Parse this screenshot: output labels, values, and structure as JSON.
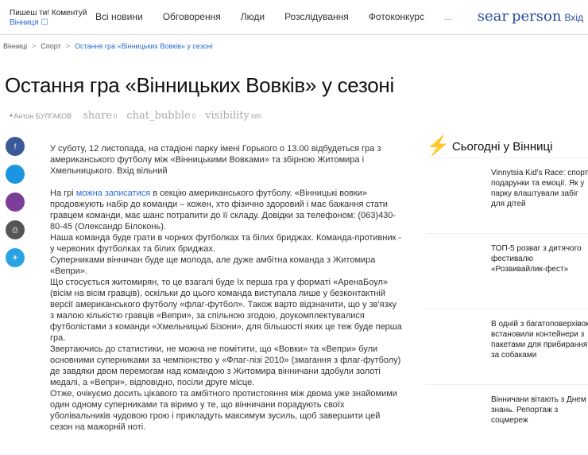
{
  "header": {
    "brand_line1": "Пишеш ти! Коментуй",
    "brand_line2": "Вінниця ☐",
    "nav": [
      "Всі новини",
      "Обговорення",
      "Люди",
      "Розслідування",
      "Фотоконкурс",
      "..."
    ],
    "search_icon": "sear",
    "person_icon": "person",
    "login": "Вхід"
  },
  "breadcrumb": {
    "items": [
      "Вінниці",
      "Спорт"
    ],
    "separator": ">",
    "current": "Остання гра «Вінницьких Вовків» у сезоні"
  },
  "article": {
    "title": "Остання гра «Вінницьких Вовків» у сезоні",
    "author": "Антон БУЛГАКОВ",
    "share_label": "share",
    "share_count": "0",
    "comments_label": "chat_bubble",
    "comments_count": "0",
    "views_label": "visibility",
    "views_count": "685",
    "lead": "У суботу, 12 листопада, на стадіоні парку імені Горького о 13.00 відбудеться гра з американського футболу між «Вінницькими Вовками» та збірною Житомира і Хмельницького. Вхід вільний",
    "p2_before": "На грі ",
    "p2_link": "можна записатися",
    "p2_after": " в секцію американського футболу. «Вінницькі вовки» продовжують набір до команди – кожен, хто фізично здоровий і має бажання стати гравцем команди, має шанс потрапити до її складу. Довідки за телефоном: (063)430-80-45 (Олександр Білоконь).",
    "p3": "Наша команда буде грати в чорних футболках та білих бриджах. Команда-противник - у червоних футболках та білих бриджах.",
    "p4": "Суперниками вінничан буде ще молода, але дуже амбітна команда з Житомира «Вепри».",
    "p5": "Що стосується житомирян, то це взагалі буде їх перша гра у форматі «АренаБоул» (вісім на вісім гравців), оскільки до цього команда виступала лише у безконтактній версії американського футболу «флаг-футбол». Також варто відзначити, що у зв'язку з малою кількістю гравців «Вепри», за спільною згодою, доукомплектувалися футболістами з команди «Хмельницькі Бізони», для більшості яких це теж буде перша гра.",
    "p6": "Звертаючись до статистики, не можна не помітити, що «Вовки» та «Вепри» були основними суперниками за чемпіонство у «Флаг-лізі 2010» (змагання з флаг-футболу) де завдяки двом перемогам над командою з Житомира вінничани здобули золоті медалі, а «Вепри», відповідно, посіли друге місце.",
    "p7": "Отже, очікуємо досить цікавого та амбітного протистояння між двома уже знайомими один одному суперниками та віримо у те, що вінничани порадують своїх уболівальників чудовою грою і прикладуть максимум зусиль, щоб завершити цей сезон на мажорній ноті."
  },
  "share_buttons": [
    {
      "icon": "facebook-icon",
      "label": "f",
      "color": "#3b5998"
    },
    {
      "icon": "twitter-icon",
      "label": "",
      "color": "#1b95e0"
    },
    {
      "icon": "viber-icon",
      "label": "",
      "color": "#7b3f98"
    },
    {
      "icon": "print-icon",
      "label": "⎙",
      "color": "#555555"
    },
    {
      "icon": "telegram-icon",
      "label": "✈",
      "color": "#2aa3e3"
    }
  ],
  "sidebar": {
    "title": "Сьогодні у Вінниці",
    "items": [
      "Vinnytsia Kid's Race: спорт, подарунки та емоції. Як у парку влаштували забіг для дітей",
      "ТОП-5 розваг з дитячого фестивалю «Розвивайлик-фест»",
      "В одній з багатоповерхівок встановили контейнери з пакетами для прибирання за собаками",
      "Вінничани вітають з Днем знань. Репортаж з соцмереж"
    ]
  },
  "colors": {
    "accent": "#2a6bd1",
    "bolt": "#e0201b"
  }
}
